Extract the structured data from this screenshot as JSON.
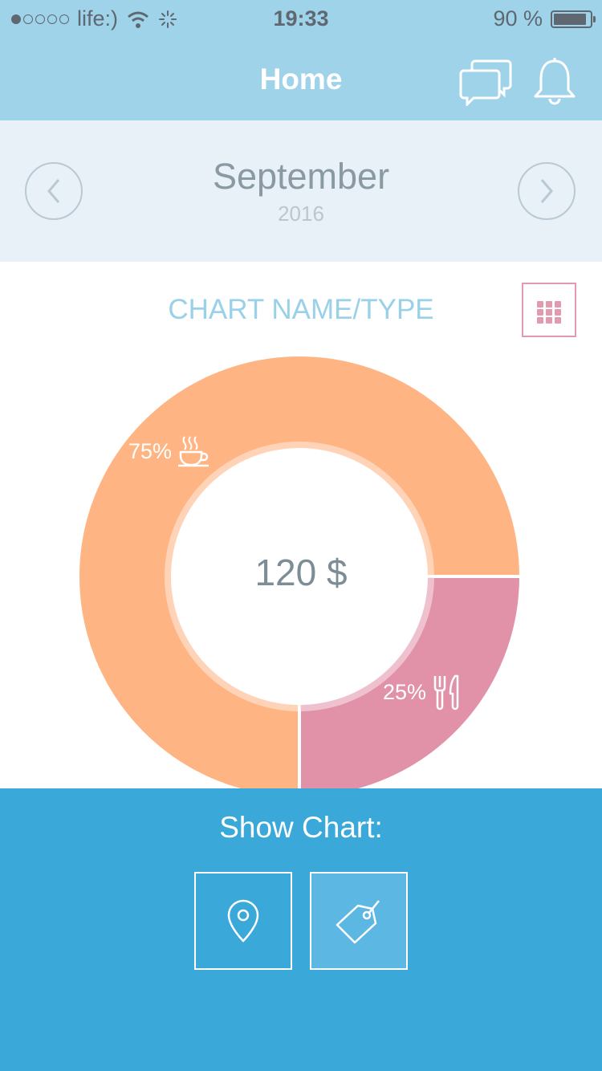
{
  "status": {
    "carrier": "life:)",
    "time": "19:33",
    "battery": "90 %",
    "battery_level": 0.9,
    "signal_filled": 1,
    "signal_total": 5
  },
  "nav": {
    "title": "Home",
    "icons": [
      "chat-icon",
      "bell-icon"
    ]
  },
  "month": {
    "name": "September",
    "year": "2016",
    "prev_icon": "chevron-left-icon",
    "next_icon": "chevron-right-icon"
  },
  "chart": {
    "title": "CHART NAME/TYPE",
    "center_label": "120 $",
    "toggle_icon": "grid-icon"
  },
  "chart_data": {
    "type": "pie",
    "slices": [
      {
        "label": "75%",
        "value": 75,
        "icon": "coffee-cup-icon",
        "color": "#ffb583"
      },
      {
        "label": "25%",
        "value": 25,
        "icon": "fork-knife-icon",
        "color": "#e192a9"
      }
    ]
  },
  "bottom": {
    "title": "Show Chart:",
    "buttons": [
      {
        "icon": "location-pin-icon",
        "active": false
      },
      {
        "icon": "price-tag-icon",
        "active": true
      }
    ]
  },
  "colors": {
    "header": "#9fd3ea",
    "month_bar": "#e8f0f8",
    "bottom": "#3aa8d8",
    "accent_pink": "#e39aae"
  }
}
